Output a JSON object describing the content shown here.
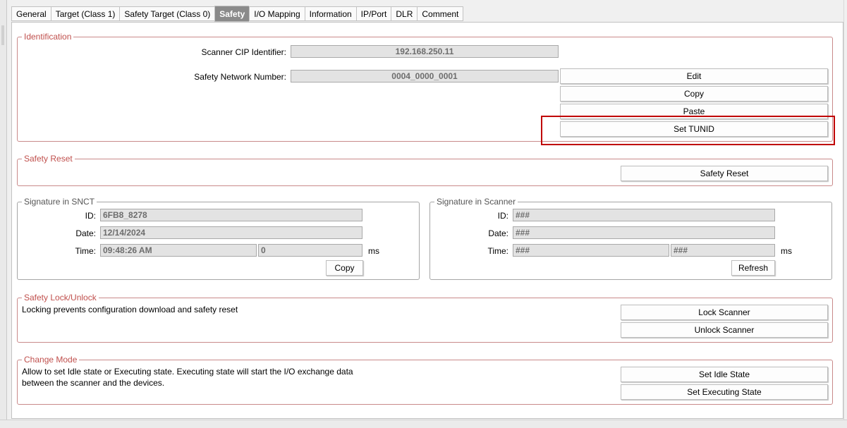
{
  "tabs": [
    {
      "label": "General"
    },
    {
      "label": "Target (Class 1)"
    },
    {
      "label": "Safety Target (Class 0)"
    },
    {
      "label": "Safety",
      "active": true
    },
    {
      "label": "I/O Mapping"
    },
    {
      "label": "Information"
    },
    {
      "label": "IP/Port"
    },
    {
      "label": "DLR"
    },
    {
      "label": "Comment"
    }
  ],
  "identification": {
    "title": "Identification",
    "scanner_cip_label": "Scanner CIP Identifier:",
    "scanner_cip_value": "192.168.250.11",
    "snn_label": "Safety Network Number:",
    "snn_value": "0004_0000_0001",
    "edit_label": "Edit",
    "copy_label": "Copy",
    "paste_label": "Paste",
    "set_tunid_label": "Set TUNID"
  },
  "safety_reset": {
    "title": "Safety Reset",
    "button_label": "Safety Reset"
  },
  "sig_snct": {
    "title": "Signature in SNCT",
    "id_label": "ID:",
    "id_value": "6FB8_8278",
    "date_label": "Date:",
    "date_value": "12/14/2024",
    "time_label": "Time:",
    "time_value": "09:48:26 AM",
    "ms_value": "0",
    "ms_label": "ms",
    "copy_label": "Copy"
  },
  "sig_scanner": {
    "title": "Signature in Scanner",
    "id_label": "ID:",
    "id_value": "###",
    "date_label": "Date:",
    "date_value": "###",
    "time_label": "Time:",
    "time_value": "###",
    "ms_value": "###",
    "ms_label": "ms",
    "refresh_label": "Refresh"
  },
  "lock": {
    "title": "Safety Lock/Unlock",
    "description": "Locking prevents configuration download and safety reset",
    "lock_label": "Lock Scanner",
    "unlock_label": "Unlock Scanner"
  },
  "change_mode": {
    "title": "Change Mode",
    "description_line1": "Allow to set Idle state or Executing state. Executing state will start the I/O exchange data",
    "description_line2": "between the scanner and the devices.",
    "idle_label": "Set Idle State",
    "exec_label": "Set Executing State"
  },
  "colors": {
    "group_border": "#c98a8a",
    "group_title": "#c0504d",
    "highlight": "#c00000",
    "active_tab": "#8a8a8a"
  }
}
